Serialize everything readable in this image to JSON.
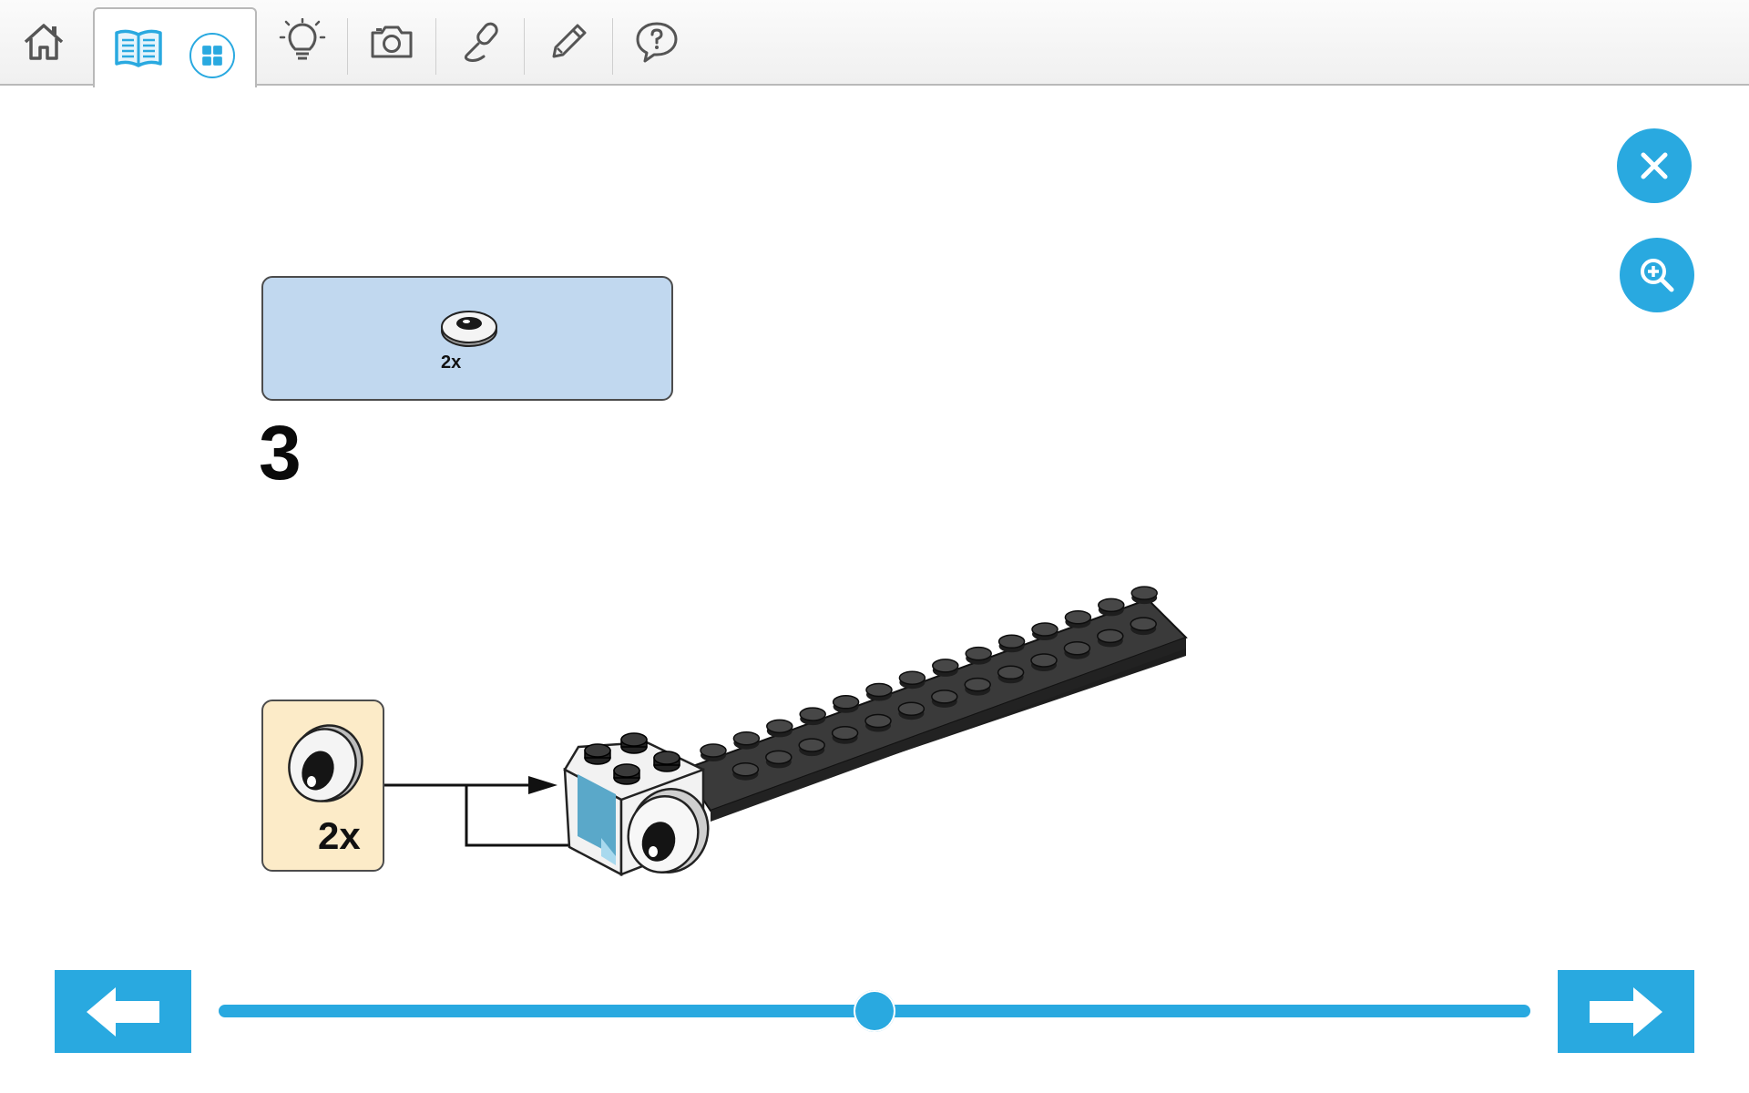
{
  "toolbar": {
    "items": [
      {
        "icon": "home-icon"
      },
      {
        "icon": "book-icon",
        "active": true
      },
      {
        "icon": "grid-icon"
      },
      {
        "icon": "lightbulb-icon"
      },
      {
        "icon": "camera-icon"
      },
      {
        "icon": "microphone-icon"
      },
      {
        "icon": "pencil-icon"
      },
      {
        "icon": "help-speech-bubble-icon"
      }
    ]
  },
  "actions": {
    "close_icon": "close-icon",
    "zoom_icon": "zoom-in-icon"
  },
  "instruction": {
    "parts_callout": {
      "quantity": "2x",
      "part": "eye-tile"
    },
    "step_number": "3",
    "subassembly_callout": {
      "quantity": "2x",
      "part": "eye-tile"
    }
  },
  "navigation": {
    "previous_icon": "arrow-left-icon",
    "next_icon": "arrow-right-icon",
    "progress": 0.5
  },
  "colors": {
    "accent": "#29a9e0",
    "parts_box_bg": "#c1d8ef",
    "subassembly_box_bg": "#fcebc8",
    "brick_dark": "#3a3a3a"
  }
}
